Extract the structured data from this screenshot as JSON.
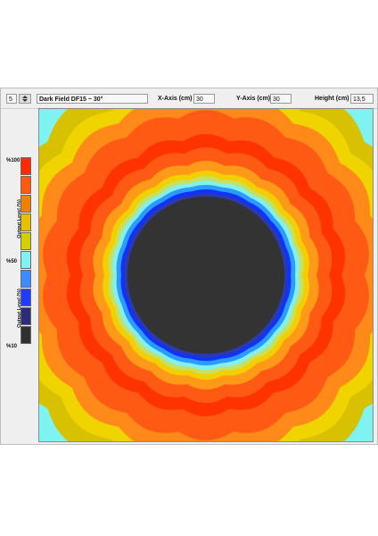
{
  "toolbar": {
    "spinner_value": "5",
    "mode_label": "Dark Field DF15 ~ 30°",
    "x_axis_label": "X-Axis (cm)",
    "x_axis_value": "30",
    "y_axis_label": "Y-Axis (cm)",
    "y_axis_value": "30",
    "height_label": "Height (cm)",
    "height_value": "13,5"
  },
  "legend": {
    "top_label": "%100",
    "mid_label": "%50",
    "bottom_label": "%10",
    "axis_label": "Output Level (%)",
    "colors": [
      "#ff2a00",
      "#ff5a10",
      "#f08000",
      "#e8c000",
      "#d4d000",
      "#7ff2f2",
      "#3b8cff",
      "#1e3cff",
      "#2c2c7a",
      "#303030"
    ]
  },
  "plot": {
    "ring_colors": [
      "#7ff2f2",
      "#d8c100",
      "#f0d400",
      "#ff8a1a",
      "#ff5a14",
      "#ff3300",
      "#ff5a14",
      "#ff9a18",
      "#f2d000",
      "#c8e060",
      "#82f0ec",
      "#2a9cff",
      "#1230ff",
      "#2a3aa8",
      "#333333"
    ]
  }
}
